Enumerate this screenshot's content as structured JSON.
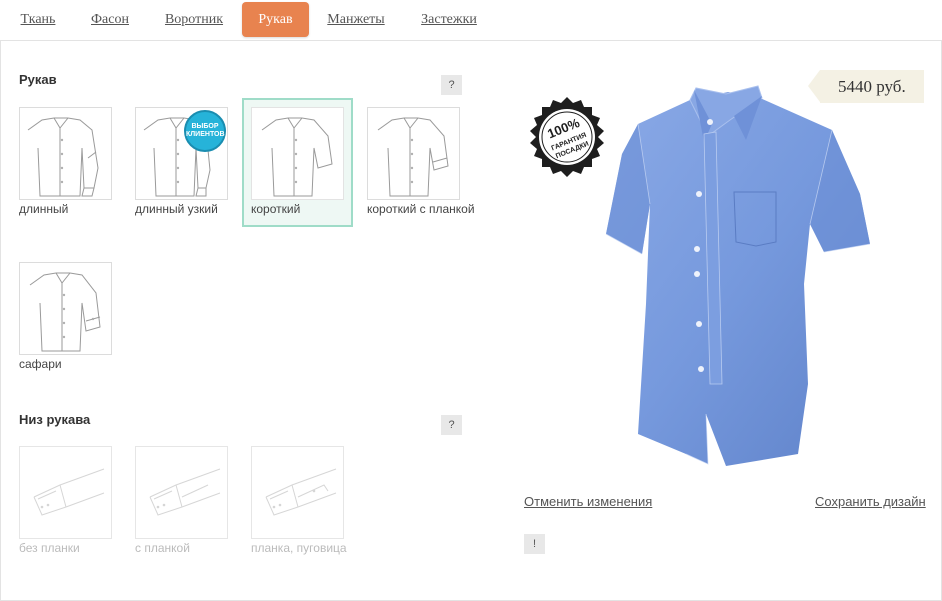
{
  "tabs": [
    {
      "label": "Ткань",
      "active": false
    },
    {
      "label": "Фасон",
      "active": false
    },
    {
      "label": "Воротник",
      "active": false
    },
    {
      "label": "Рукав",
      "active": true
    },
    {
      "label": "Манжеты",
      "active": false
    },
    {
      "label": "Застежки",
      "active": false
    }
  ],
  "sleeve": {
    "title": "Рукав",
    "help": "?",
    "options": [
      {
        "label": "длинный",
        "selected": false
      },
      {
        "label": "длинный узкий",
        "selected": false,
        "badge": [
          "ВЫБОР",
          "КЛИЕНТОВ"
        ]
      },
      {
        "label": "короткий",
        "selected": true
      },
      {
        "label": "короткий с планкой",
        "selected": false
      },
      {
        "label": "сафари",
        "selected": false
      }
    ]
  },
  "sleeve_bottom": {
    "title": "Низ рукава",
    "help": "?",
    "options": [
      {
        "label": "без планки",
        "disabled": true
      },
      {
        "label": "с планкой",
        "disabled": true
      },
      {
        "label": "планка, пуговица",
        "disabled": true
      }
    ]
  },
  "price": "5440 руб.",
  "seal": {
    "line1": "100%",
    "line2": "ГАРАНТИЯ",
    "line3": "ПОСАДКИ"
  },
  "actions": {
    "cancel": "Отменить изменения",
    "save": "Сохранить дизайн",
    "info": "!"
  },
  "colors": {
    "accent": "#e8834f",
    "selected_border": "#9fdcc8",
    "shirt": "#7b9ee0",
    "badge": "#26b3d9"
  }
}
